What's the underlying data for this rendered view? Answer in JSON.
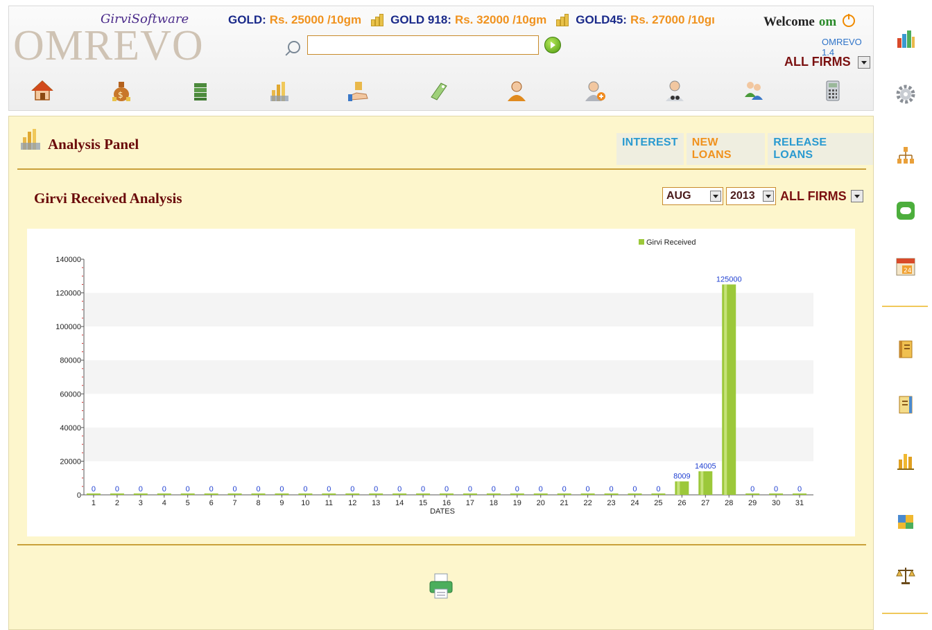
{
  "header": {
    "brand_subtitle": "GirviSoftware",
    "brand_logo_text": "OMREVO",
    "rates": [
      {
        "label": "GOLD:",
        "value": "Rs. 25000 /10gm"
      },
      {
        "label": "GOLD 918:",
        "value": "Rs. 32000 /10gm"
      },
      {
        "label": "GOLD45:",
        "value": "Rs. 27000 /10gı"
      }
    ],
    "welcome_label": "Welcome",
    "welcome_user": "om",
    "version": "OMREVO 1.4",
    "firm_select": "ALL FIRMS",
    "search": {
      "value": "",
      "placeholder": ""
    }
  },
  "toolbar": {
    "icons": [
      "home-icon",
      "money-bag-icon",
      "cash-stack-icon",
      "analysis-chart-icon",
      "loan-hand-icon",
      "price-tag-icon",
      "customer-icon",
      "add-customer-icon",
      "search-customer-icon",
      "users-group-icon",
      "calculator-icon"
    ]
  },
  "panel": {
    "title": "Analysis Panel",
    "tabs": {
      "interest": "INTEREST",
      "new_loans": "NEW LOANS",
      "release_loans": "RELEASE LOANS"
    },
    "analysis_title": "Girvi Received Analysis",
    "filters": {
      "month": "AUG",
      "year": "2013",
      "firm": "ALL FIRMS"
    }
  },
  "sidebar": {
    "icons": [
      "reports-chart-icon",
      "settings-gear-icon",
      "hierarchy-icon",
      "sms-icon",
      "calendar-icon",
      "ledger-book-icon",
      "notebook-icon",
      "bar-chart-icon",
      "puzzle-icon",
      "balance-scale-icon"
    ]
  },
  "colors": {
    "accent_maroon": "#6a0a0a",
    "rate_value": "#f0921e",
    "rate_label": "#1a2a8a",
    "bar_green": "#9cc83a",
    "panel_bg": "#fdf6cc",
    "data_label": "#1f3fd1"
  },
  "chart_data": {
    "type": "bar",
    "xlabel": "DATES",
    "ylabel": "",
    "ylim": [
      0,
      140000
    ],
    "yticks": [
      0,
      20000,
      40000,
      60000,
      80000,
      100000,
      120000,
      140000
    ],
    "legend_position": "top-right",
    "categories": [
      "1",
      "2",
      "3",
      "4",
      "5",
      "6",
      "7",
      "8",
      "9",
      "10",
      "11",
      "12",
      "13",
      "14",
      "15",
      "16",
      "17",
      "18",
      "19",
      "20",
      "21",
      "22",
      "23",
      "24",
      "25",
      "26",
      "27",
      "28",
      "29",
      "30",
      "31"
    ],
    "series": [
      {
        "name": "Girvi Received",
        "color": "#9cc83a",
        "values": [
          0,
          0,
          0,
          0,
          0,
          0,
          0,
          0,
          0,
          0,
          0,
          0,
          0,
          0,
          0,
          0,
          0,
          0,
          0,
          0,
          0,
          0,
          0,
          0,
          0,
          8009,
          14005,
          125000,
          0,
          0,
          0
        ]
      }
    ]
  }
}
